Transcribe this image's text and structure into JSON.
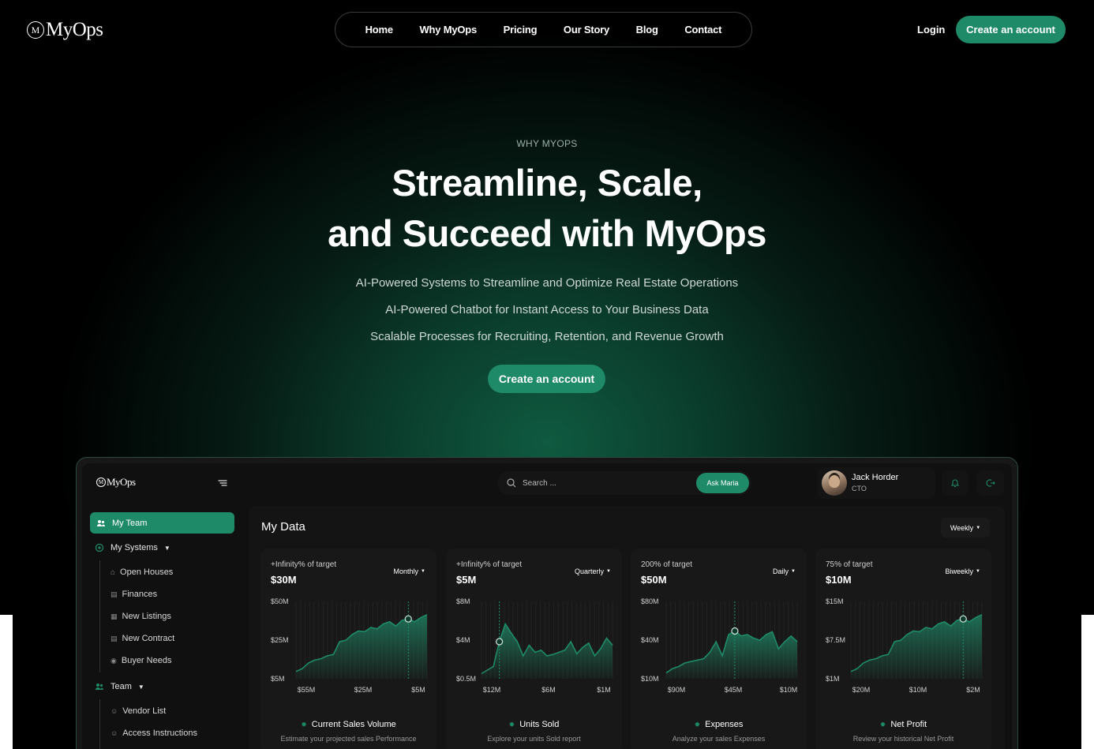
{
  "brand": {
    "name": "MyOps",
    "mark": "M"
  },
  "nav": {
    "links": [
      "Home",
      "Why MyOps",
      "Pricing",
      "Our Story",
      "Blog",
      "Contact"
    ],
    "login": "Login",
    "cta": "Create an account"
  },
  "hero": {
    "eyebrow": "WHY MYOPS",
    "headline_line1": "Streamline, Scale,",
    "headline_line2": "and Succeed with MyOps",
    "bullets": [
      "AI-Powered Systems to Streamline and Optimize Real Estate Operations",
      "AI-Powered Chatbot for Instant Access to Your Business Data",
      "Scalable Processes for Recruiting, Retention, and Revenue Growth"
    ],
    "cta": "Create an account"
  },
  "dashboard": {
    "search_placeholder": "Search ...",
    "ask_button": "Ask Maria",
    "user": {
      "name": "Jack Horder",
      "role": "CTO"
    },
    "sidebar": {
      "my_team": "My Team",
      "my_systems": "My Systems",
      "systems_items": [
        "Open Houses",
        "Finances",
        "New Listings",
        "New Contract",
        "Buyer Needs"
      ],
      "team": "Team",
      "team_items": [
        "Vendor List",
        "Access Instructions"
      ]
    },
    "title": "My Data",
    "range": "Weekly",
    "accent": "#1f8a68",
    "cards": [
      {
        "pct": "+Infinity% of target",
        "value": "$30M",
        "period": "Monthly",
        "title": "Current Sales Volume",
        "desc": "Estimate your projected sales Performance",
        "chart_data": {
          "type": "area",
          "ylabels": [
            "$50M",
            "$25M",
            "$5M"
          ],
          "xlabels": [
            "$55M",
            "$25M",
            "$5M"
          ],
          "values": [
            0.08,
            0.12,
            0.2,
            0.24,
            0.26,
            0.3,
            0.32,
            0.5,
            0.52,
            0.6,
            0.65,
            0.64,
            0.7,
            0.68,
            0.75,
            0.78,
            0.72,
            0.8,
            0.82,
            0.78,
            0.84,
            0.88
          ],
          "marker_index": 18
        }
      },
      {
        "pct": "+Infinity% of target",
        "value": "$5M",
        "period": "Quarterly",
        "title": "Units Sold",
        "desc": "Explore your units Sold report",
        "chart_data": {
          "type": "area",
          "ylabels": [
            "$8M",
            "$4M",
            "$0.5M"
          ],
          "xlabels": [
            "$12M",
            "$6M",
            "$1M"
          ],
          "values": [
            0.05,
            0.1,
            0.15,
            0.5,
            0.75,
            0.62,
            0.5,
            0.3,
            0.45,
            0.35,
            0.38,
            0.3,
            0.32,
            0.35,
            0.38,
            0.5,
            0.33,
            0.42,
            0.48,
            0.3,
            0.4,
            0.55,
            0.45
          ],
          "marker_index": 3
        }
      },
      {
        "pct": "200% of target",
        "value": "$50M",
        "period": "Daily",
        "title": "Expenses",
        "desc": "Analyze your sales Expenses",
        "chart_data": {
          "type": "area",
          "ylabels": [
            "$80M",
            "$40M",
            "$10M"
          ],
          "xlabels": [
            "$90M",
            "$45M",
            "$10M"
          ],
          "values": [
            0.06,
            0.12,
            0.15,
            0.2,
            0.22,
            0.24,
            0.26,
            0.35,
            0.5,
            0.3,
            0.6,
            0.65,
            0.58,
            0.6,
            0.55,
            0.52,
            0.6,
            0.64,
            0.4,
            0.5,
            0.58,
            0.5
          ],
          "marker_index": 11
        }
      },
      {
        "pct": "75% of target",
        "value": "$10M",
        "period": "Biweekly",
        "title": "Net Profit",
        "desc": "Review your historical Net Profit",
        "chart_data": {
          "type": "area",
          "ylabels": [
            "$15M",
            "$7.5M",
            "$1M"
          ],
          "xlabels": [
            "$20M",
            "$10M",
            "$2M"
          ],
          "values": [
            0.08,
            0.12,
            0.2,
            0.24,
            0.26,
            0.3,
            0.32,
            0.5,
            0.52,
            0.6,
            0.65,
            0.64,
            0.7,
            0.68,
            0.75,
            0.78,
            0.72,
            0.8,
            0.82,
            0.78,
            0.84,
            0.88
          ],
          "marker_index": 18
        }
      }
    ]
  }
}
